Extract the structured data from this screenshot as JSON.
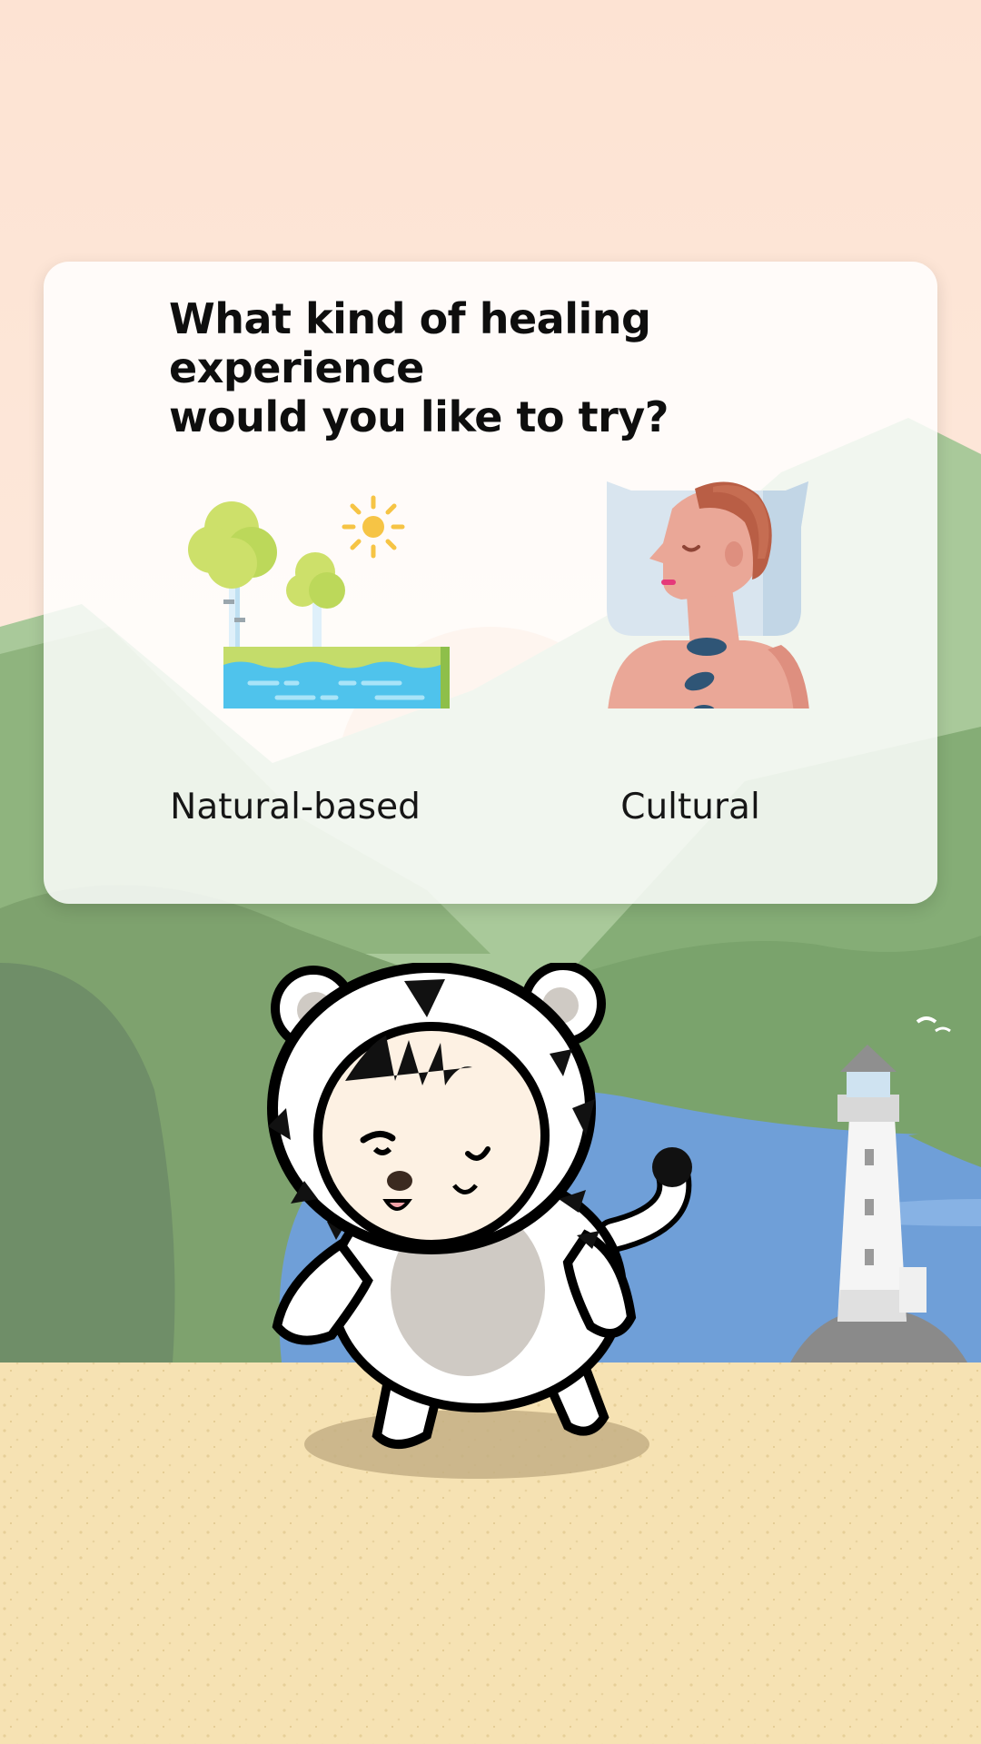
{
  "question": {
    "line1": "What kind of healing experience",
    "line2": "would you like to try?"
  },
  "options": [
    {
      "label": "Natural-based",
      "icon": "nature-landscape-icon"
    },
    {
      "label": "Cultural",
      "icon": "hot-stone-massage-icon"
    }
  ],
  "colors": {
    "sky": "#fde5d5",
    "hills": "#7aa36c",
    "river": "#6f9fd8",
    "sand": "#f6e2b3",
    "card": "#ffffff"
  }
}
